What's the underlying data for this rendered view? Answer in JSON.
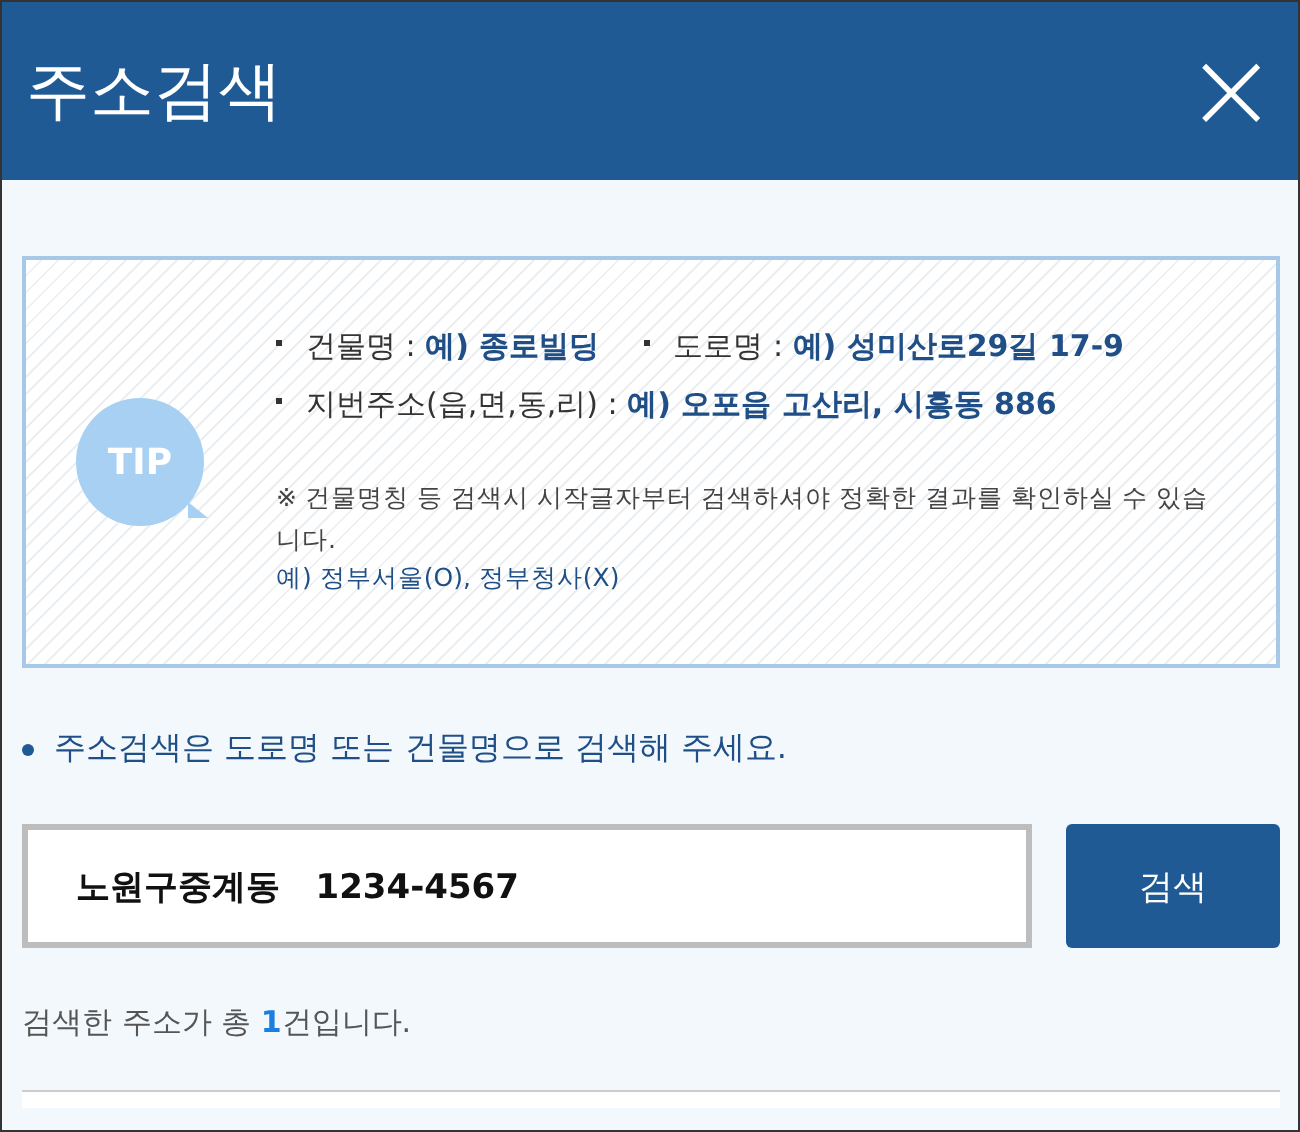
{
  "window": {
    "title": "주소검색",
    "close": "×"
  },
  "tip": {
    "badge": "TIP",
    "examples": [
      {
        "text": "건물명 : **예) 종로빌딩**"
      },
      {
        "text": "도로명 : **예) 성미산로29길 17-9**"
      },
      {
        "text": "지번주소(읍,면,동,리) : **예) 오포읍 고산리, 시흥동 886**"
      }
    ],
    "note": "※ 건물명칭 등 검색시 시작글자부터 검색하셔야 정확한 결과를 확인하실 수 있습니다.",
    "note_example": "예) 정부서울(O), 정부청사(X)"
  },
  "guide": "주소검색은 도로명 또는 건물명으로 검색해 주세요.",
  "search": {
    "value": "노원구중계동   1234-4567",
    "button": "검색"
  },
  "result": {
    "prefix": "검색한 주소가 총 ",
    "count": "1",
    "suffix": "건입니다."
  }
}
